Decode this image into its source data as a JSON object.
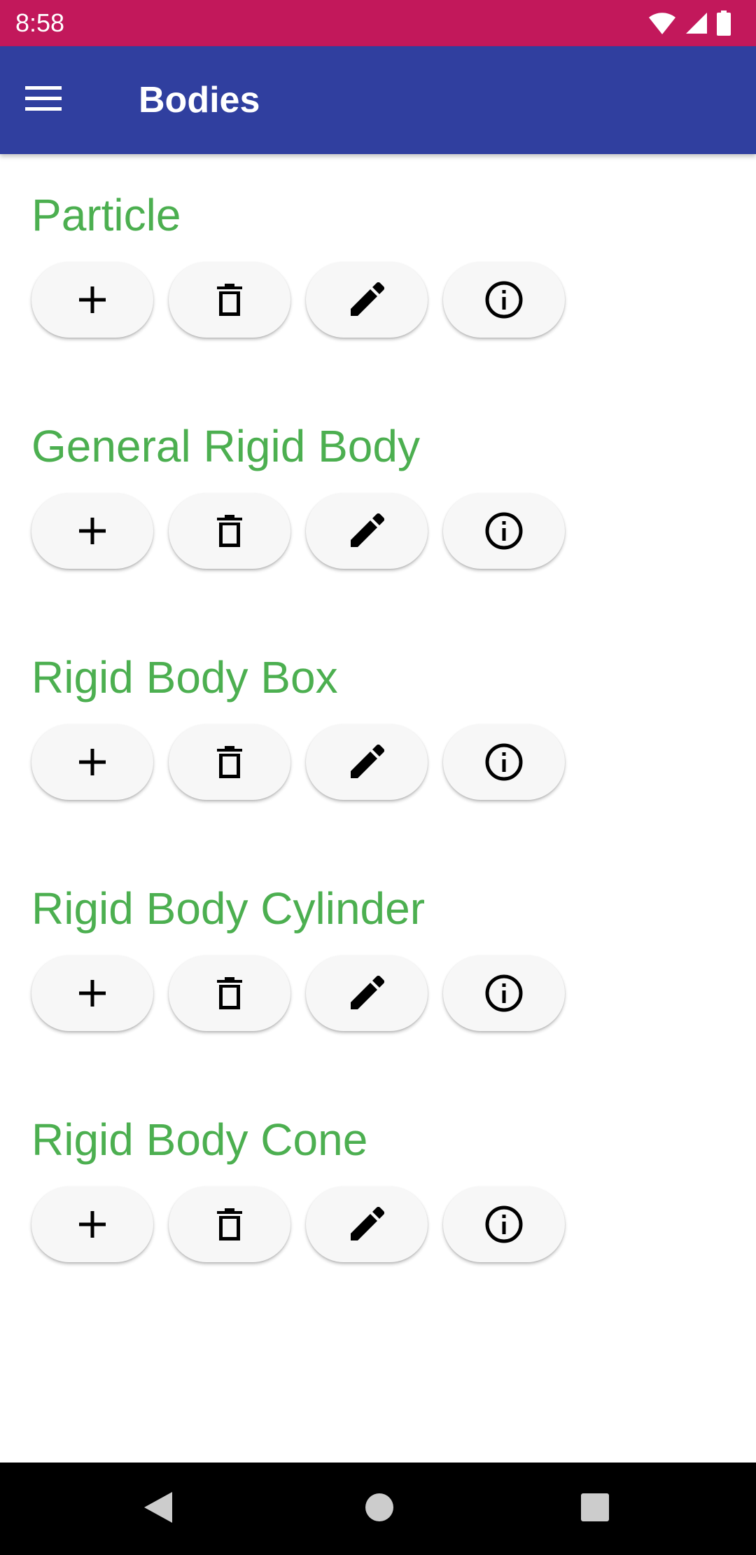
{
  "status_bar": {
    "time": "8:58",
    "background_color": "#C2185B",
    "icons": [
      "wifi-icon",
      "signal-icon",
      "battery-icon"
    ]
  },
  "app_bar": {
    "title": "Bodies",
    "menu_icon": "menu-icon",
    "background_color": "#303F9F"
  },
  "accent_color": "#4CAF50",
  "sections": [
    {
      "title": "Particle"
    },
    {
      "title": "General Rigid Body"
    },
    {
      "title": "Rigid Body Box"
    },
    {
      "title": "Rigid Body Cylinder"
    },
    {
      "title": "Rigid Body Cone"
    }
  ],
  "section_buttons": [
    {
      "icon": "add-icon",
      "action": "add"
    },
    {
      "icon": "delete-icon",
      "action": "delete"
    },
    {
      "icon": "edit-icon",
      "action": "edit"
    },
    {
      "icon": "info-icon",
      "action": "info"
    }
  ],
  "nav_bar": {
    "buttons": [
      "back-icon",
      "home-icon",
      "recents-icon"
    ]
  }
}
